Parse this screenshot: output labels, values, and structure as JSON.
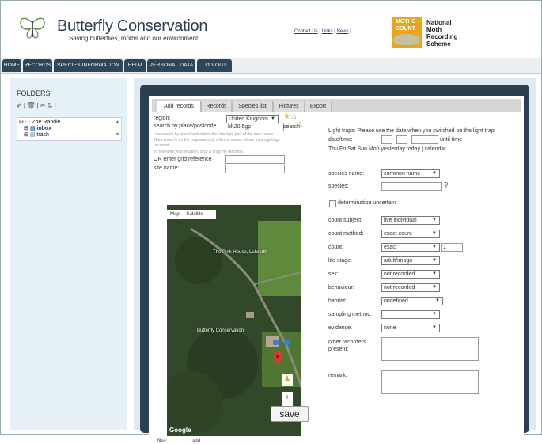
{
  "header": {
    "title": "Butterfly Conservation",
    "subtitle": "Saving butterflies, moths and our environment",
    "links": [
      "Contact Us",
      "Links",
      "News"
    ],
    "badge_line1": "MOTHS",
    "badge_line2": "COUNT",
    "scheme": [
      "National",
      "Moth",
      "Recording",
      "Scheme"
    ]
  },
  "nav": [
    "HOME",
    "RECORDS",
    "SPECIES INFORMATION",
    "HELP",
    "PERSONAL DATA",
    "LOG OUT"
  ],
  "folders": {
    "title": "FOLDERS",
    "tools": "✐ | 🗑 | ✂ ⇅ |",
    "tree": [
      "Zoe Randle",
      "inbox",
      "trash"
    ]
  },
  "tabs": [
    "Add records",
    "Records",
    "Species list",
    "Pictures",
    "Export"
  ],
  "form": {
    "region_label": "region:",
    "region_value": "United Kingdom",
    "search_label": "search by place/postcode",
    "search_value": "bh20 5gp",
    "search_btn": "search",
    "hint1": "Use search by place/postcode to find the right part of the map below.",
    "hint2": "Then zoom in on the map and click with the mouse where your sightings",
    "hint3": "occurred.",
    "hint4": "To fine-tune your location, click & drag the teardrop.",
    "grid_label": "OR enter grid reference :",
    "site_label": "site name:",
    "light_traps": "Light traps: Please use the date when you switched on the light trap.",
    "datetime_label": "date/time:",
    "until_label": "until time",
    "date_quick": "Thu Fri Sat Sun Mon yesterday today | calendar...",
    "species_name_label": "species name:",
    "species_name_value": "common name",
    "species_label": "species:",
    "det_uncertain": "determination uncertain",
    "count_subject_label": "count subject:",
    "count_subject_value": "live individual",
    "count_method_label": "count method:",
    "count_method_value": "exact count",
    "count_label": "count:",
    "count_value": "exact",
    "count_num": "1",
    "life_stage_label": "life stage:",
    "life_stage_value": "adult/imago",
    "sex_label": "sex:",
    "sex_value": "not recorded",
    "behaviour_label": "behaviour:",
    "behaviour_value": "not recorded",
    "habitat_label": "habitat:",
    "habitat_value": "undefined",
    "sampling_label": "sampling method:",
    "evidence_label": "evidence:",
    "evidence_value": "none",
    "other_rec_label": "other recorders present:",
    "remark_label": "remark:",
    "save": "save",
    "files_label": "files:",
    "files_add": "add"
  },
  "map": {
    "type_map": "Map",
    "type_sat": "Satellite",
    "place1": "The Pink House, Lulworth",
    "place2": "Butterfly Conservation",
    "google": "Google"
  }
}
